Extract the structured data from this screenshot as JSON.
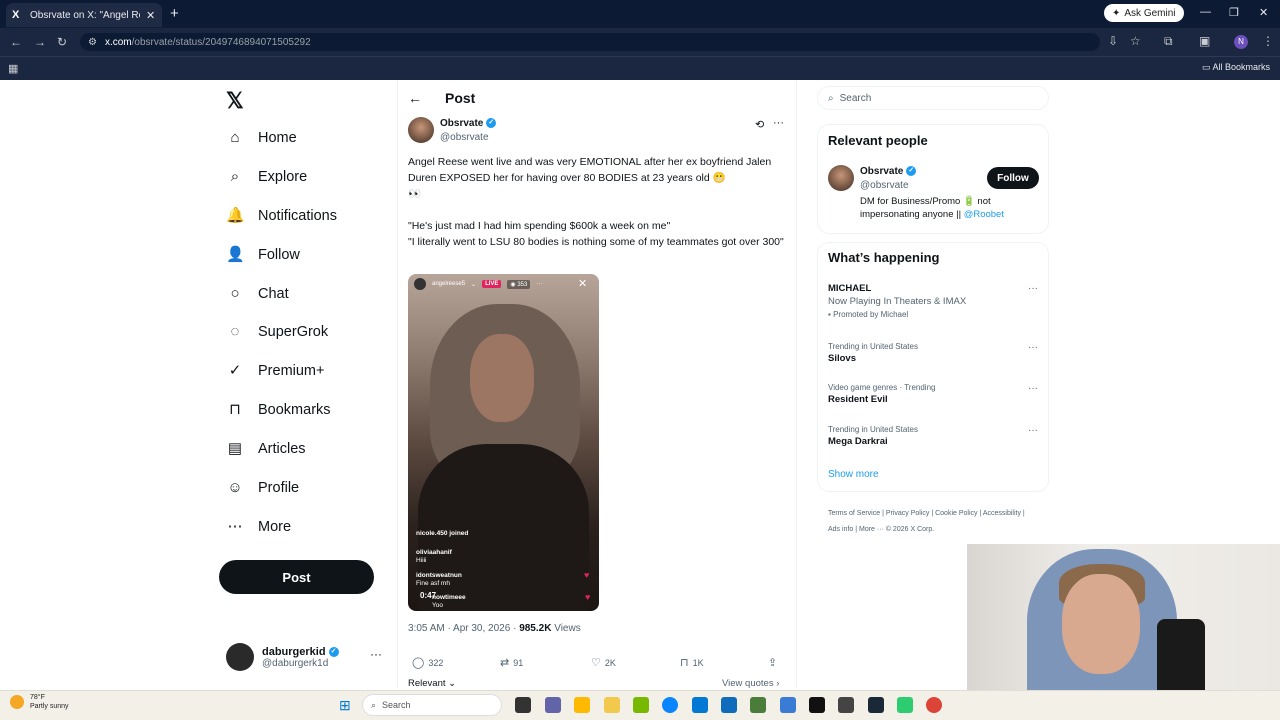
{
  "browser": {
    "tab_title": "Obsrvate on X: \"Angel Reese w",
    "tab_favicon": "X",
    "new_tab": "+",
    "gemini_label": "Ask Gemini",
    "url_host": "x.com",
    "url_path": "/obsrvate/status/2049746894071505292",
    "profile_initial": "N",
    "all_bookmarks": "All Bookmarks"
  },
  "nav": {
    "logo": "𝕏",
    "items": [
      {
        "label": "Home",
        "icon": "⌂"
      },
      {
        "label": "Explore",
        "icon": "⌕"
      },
      {
        "label": "Notifications",
        "icon": "🔔"
      },
      {
        "label": "Follow",
        "icon": "👤"
      },
      {
        "label": "Chat",
        "icon": "○"
      },
      {
        "label": "SuperGrok",
        "icon": "◌"
      },
      {
        "label": "Premium+",
        "icon": "✓"
      },
      {
        "label": "Bookmarks",
        "icon": "⊓"
      },
      {
        "label": "Articles",
        "icon": "▤"
      },
      {
        "label": "Profile",
        "icon": "☺"
      },
      {
        "label": "More",
        "icon": "⋯"
      }
    ],
    "post_button": "Post",
    "account": {
      "name": "daburgerkid",
      "handle": "@daburgerk1d",
      "more": "···"
    }
  },
  "post": {
    "back": "←",
    "header": "Post",
    "author_name": "Obsrvate",
    "author_handle": "@obsrvate",
    "more": "···",
    "text": "Angel Reese went live and was very EMOTIONAL after her ex boyfriend Jalen Duren EXPOSED her for having over 80 BODIES at 23 years old 😬\n👀\n\n\"He's just mad I had him spending $600k a week on me\"\n\"I literally went to LSU 80 bodies is nothing some of my teammates got over 300\"",
    "media": {
      "username": "angelreese5",
      "live": "LIVE",
      "viewers": "353",
      "comments": [
        {
          "user": "nicole.450 joined",
          "msg": ""
        },
        {
          "user": "oliviaahanif",
          "msg": "Hiiii"
        },
        {
          "user": "idontsweatnun",
          "msg": "Fine asf mh"
        },
        {
          "user": "nowtimeee",
          "msg": "Yoo"
        }
      ],
      "duration": "0:47"
    },
    "time": "3:05 AM · Apr 30, 2026 · ",
    "views_count": "985.2K",
    "views_label": " Views",
    "replies": "322",
    "reposts": "91",
    "likes": "2K",
    "bookmarks": "1K",
    "relevant": "Relevant ⌄",
    "view_quotes": "View quotes ›"
  },
  "right": {
    "search_placeholder": "Search",
    "relevant_heading": "Relevant people",
    "person": {
      "name": "Obsrvate",
      "handle": "@obsrvate",
      "follow": "Follow",
      "bio": "DM for Business/Promo 🔋 not impersonating anyone || ",
      "bio_link": "@Roobet"
    },
    "whats_heading": "What’s happening",
    "trends": [
      {
        "context": "",
        "title": "MICHAEL",
        "sub": "Now Playing In Theaters & IMAX",
        "promo": "Promoted by Michael"
      },
      {
        "context": "Trending in United States",
        "title": "Silovs",
        "sub": "",
        "promo": ""
      },
      {
        "context": "Video game genres · Trending",
        "title": "Resident Evil",
        "sub": "",
        "promo": ""
      },
      {
        "context": "Trending in United States",
        "title": "Mega Darkrai",
        "sub": "",
        "promo": ""
      }
    ],
    "show_more": "Show more",
    "footer": "Terms of Service  |  Privacy Policy  |  Cookie Policy  |  Accessibility  |  Ads info  |  More ···  © 2026 X Corp."
  },
  "taskbar": {
    "temp": "78°F",
    "condition": "Partly sunny",
    "search": "Search"
  }
}
